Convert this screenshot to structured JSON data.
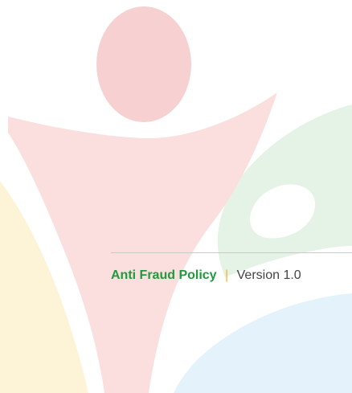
{
  "background": {
    "logo_name": "human-figure-logo-watermark",
    "colors": {
      "head": "#f7d1d1",
      "body": "#fbdede",
      "green": "#e4f3e6",
      "yellow": "#fdf4d8",
      "blue": "#e3f2fb"
    }
  },
  "document": {
    "title": "Anti Fraud Policy",
    "separator": "|",
    "version": "Version 1.0",
    "colors": {
      "title": "#1f9a3c",
      "separator": "#f2b72f",
      "version": "#444444",
      "rule": "#c9c9c9"
    }
  }
}
